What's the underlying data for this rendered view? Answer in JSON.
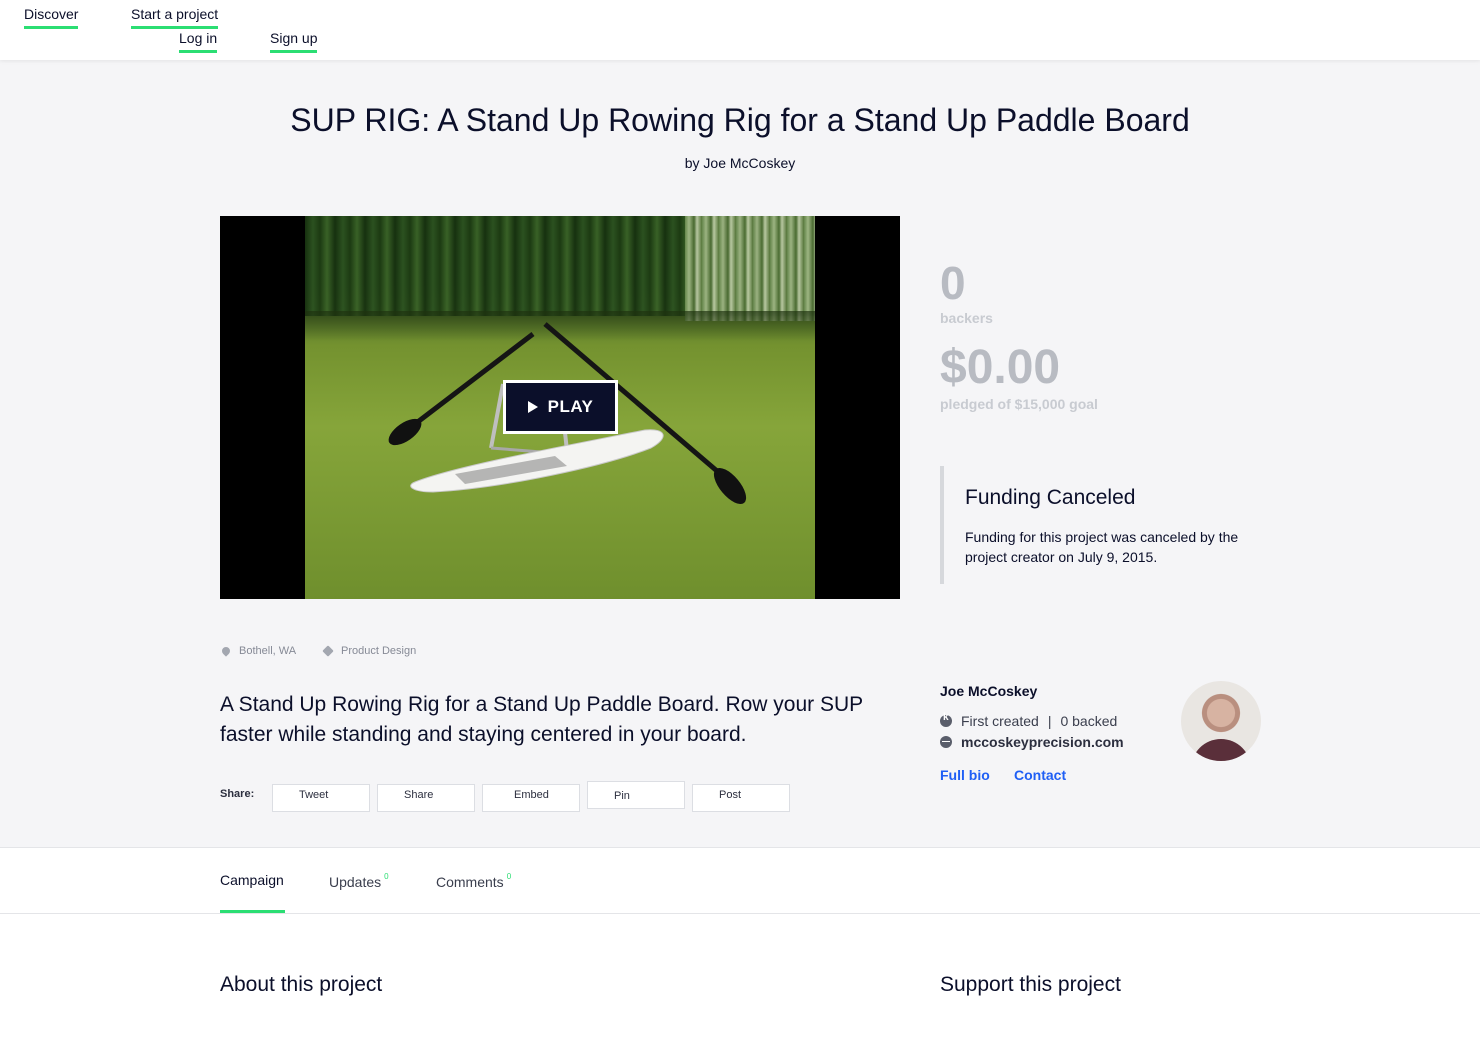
{
  "nav": {
    "discover": "Discover",
    "start_project": "Start a project",
    "log_in": "Log in",
    "sign_up": "Sign up"
  },
  "project": {
    "title": "SUP RIG: A Stand Up Rowing Rig for a Stand Up Paddle Board",
    "byline": "by Joe McCoskey",
    "play_label": "PLAY",
    "location": "Bothell, WA",
    "category": "Product Design",
    "blurb": "A Stand Up Rowing Rig for a Stand Up Paddle Board. Row your SUP faster while standing and staying centered in your board."
  },
  "stats": {
    "backers_count": "0",
    "backers_label": "backers",
    "pledged_amount": "$0.00",
    "pledged_label": "pledged of $15,000 goal"
  },
  "status": {
    "title": "Funding Canceled",
    "text": "Funding for this project was canceled by the project creator on July 9, 2015."
  },
  "share": {
    "label": "Share:",
    "buttons": [
      "Tweet",
      "Share",
      "Embed",
      "Pin",
      "Post"
    ]
  },
  "creator": {
    "name": "Joe McCoskey",
    "first_created": "First created",
    "separator": "|",
    "backed": "0 backed",
    "website": "mccoskeyprecision.com",
    "full_bio": "Full bio",
    "contact": "Contact"
  },
  "tabs": [
    {
      "label": "Campaign",
      "count": ""
    },
    {
      "label": "Updates",
      "count": "0"
    },
    {
      "label": "Comments",
      "count": "0"
    }
  ],
  "sections": {
    "about": "About this project",
    "support": "Support this project"
  },
  "colors": {
    "accent": "#2bde73",
    "link": "#1f5ff5",
    "navy": "#0b0f2a"
  }
}
